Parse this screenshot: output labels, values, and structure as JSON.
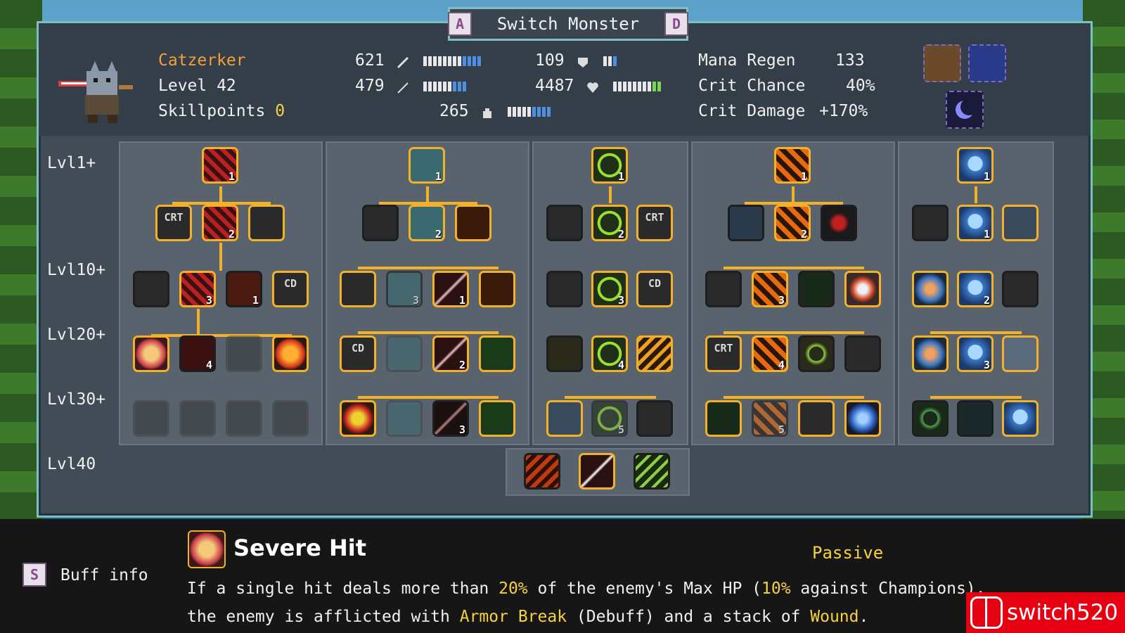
{
  "header": {
    "title": "Switch Monster",
    "key_left": "A",
    "key_right": "D"
  },
  "monster": {
    "name": "Catzerker",
    "level": "Level 42",
    "skillpoints_label": "Skillpoints",
    "skillpoints_value": "0"
  },
  "stats": {
    "atk": "621",
    "def": "109",
    "matk": "479",
    "hp": "4487",
    "mana": "265",
    "mana_regen_label": "Mana Regen",
    "mana_regen": "133",
    "crit_chance_label": "Crit Chance",
    "crit_chance": "40%",
    "crit_damage_label": "Crit Damage",
    "crit_damage": "+170%"
  },
  "levels": [
    "Lvl1+",
    "Lvl10+",
    "Lvl20+",
    "Lvl30+",
    "Lvl40"
  ],
  "skill_text": {
    "crit": "CRT",
    "cd": "CD"
  },
  "info": {
    "key": "S",
    "buff_label": "Buff info",
    "skill_name": "Severe Hit",
    "skill_type": "Passive",
    "desc_1": "If a single hit deals more than ",
    "hl_1": "20%",
    "desc_2": " of the enemy's Max HP (",
    "hl_2": "10%",
    "desc_3": " against Champions),",
    "desc_4": "the enemy is afflicted with ",
    "hl_3": "Armor Break",
    "desc_5": " (Debuff) and a stack of ",
    "hl_4": "Wound",
    "desc_6": "."
  },
  "watermark": "switch520"
}
